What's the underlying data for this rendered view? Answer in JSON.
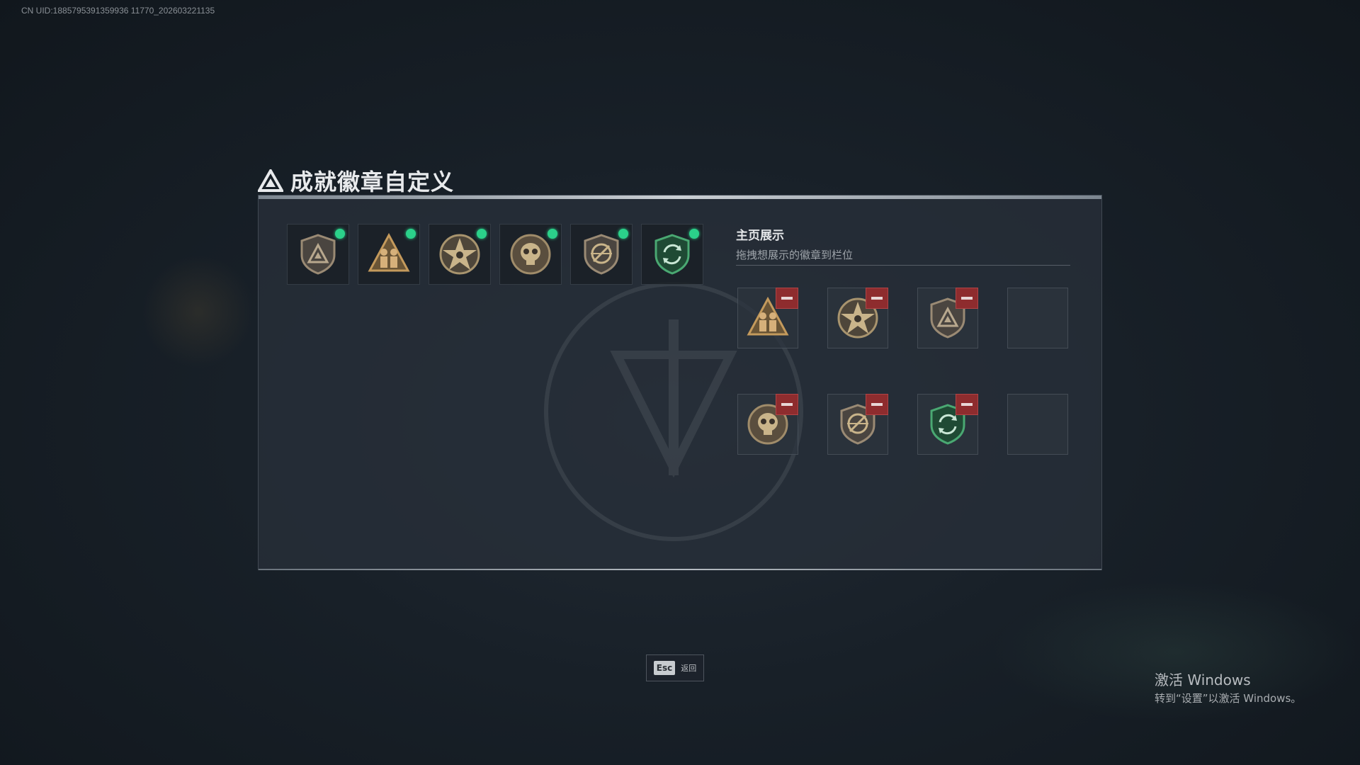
{
  "uid_text": "CN UID:1885795391359936 11770_202603221135",
  "dialog": {
    "title": "成就徽章自定义",
    "title_icon": "triangle-logo-icon"
  },
  "owned_badges": [
    {
      "name": "shield-triangle-badge",
      "color": "#8a7a68",
      "equipped": true
    },
    {
      "name": "triangle-soldiers-badge",
      "color": "#b08c56",
      "equipped": true
    },
    {
      "name": "star-badge",
      "color": "#a8946e",
      "equipped": true
    },
    {
      "name": "skull-badge",
      "color": "#a08c6a",
      "equipped": true
    },
    {
      "name": "shield-no-rifle-badge",
      "color": "#8a7a68",
      "equipped": true
    },
    {
      "name": "green-shield-arrows-badge",
      "color": "#3a8a5c",
      "equipped": true
    }
  ],
  "display": {
    "title": "主页展示",
    "subtitle": "拖拽想展示的徽章到栏位",
    "slots": [
      {
        "badge": "triangle-soldiers-badge",
        "filled": true
      },
      {
        "badge": "star-badge",
        "filled": true
      },
      {
        "badge": "shield-triangle-badge",
        "filled": true
      },
      {
        "badge": "",
        "filled": false
      },
      {
        "badge": "skull-badge",
        "filled": true
      },
      {
        "badge": "shield-no-rifle-badge",
        "filled": true
      },
      {
        "badge": "green-shield-arrows-badge",
        "filled": true
      },
      {
        "badge": "",
        "filled": false
      }
    ]
  },
  "footer": {
    "esc_key": "Esc",
    "esc_label": "返回"
  },
  "windows_activation": {
    "line1": "激活 Windows",
    "line2": "转到“设置”以激活 Windows。"
  },
  "colors": {
    "equipped_dot": "#2bd18a",
    "remove_button": "#8e2c2e",
    "panel_bg": "#28303a"
  }
}
